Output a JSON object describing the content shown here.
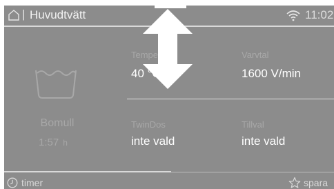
{
  "header": {
    "title": "Huvudtvätt",
    "separator": "|",
    "time": "11:02",
    "home_icon": "home-icon",
    "wifi_icon": "wifi-icon"
  },
  "program": {
    "name": "Bomull",
    "duration": "1:57",
    "duration_unit": "h",
    "icon": "wash-tub-icon"
  },
  "settings": {
    "temperature": {
      "label": "Temperatur",
      "value": "40 °C"
    },
    "spin": {
      "label": "Varvtal",
      "value": "1600 V/min"
    },
    "twindos": {
      "label": "TwinDos",
      "value": "inte vald"
    },
    "options": {
      "label": "Tillval",
      "value": "inte vald"
    }
  },
  "footer": {
    "timer_label": "timer",
    "save_label": "spara",
    "timer_icon": "clock-icon",
    "save_icon": "star-icon"
  },
  "overlay": {
    "icon": "vertical-double-arrow-icon"
  },
  "colors": {
    "screen_background": "#8c8c8c",
    "text_primary": "#ffffff",
    "text_dimmed": "#a8a8a8"
  }
}
